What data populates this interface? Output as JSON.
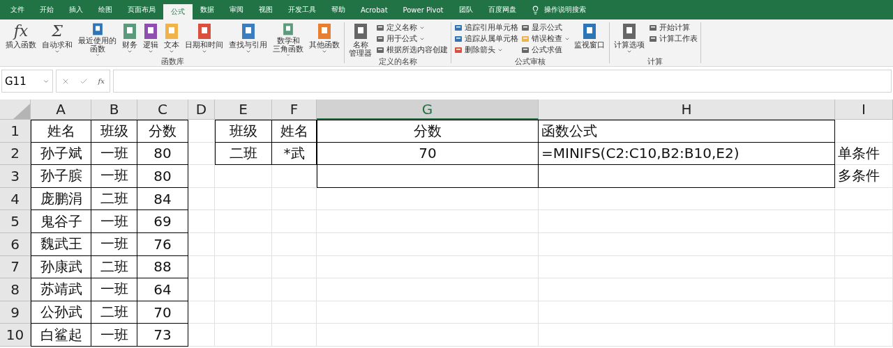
{
  "ribbon_tabs": [
    {
      "label": "文件",
      "selected": false
    },
    {
      "label": "开始",
      "selected": false
    },
    {
      "label": "插入",
      "selected": false
    },
    {
      "label": "绘图",
      "selected": false
    },
    {
      "label": "页面布局",
      "selected": false
    },
    {
      "label": "公式",
      "selected": true
    },
    {
      "label": "数据",
      "selected": false
    },
    {
      "label": "审阅",
      "selected": false
    },
    {
      "label": "视图",
      "selected": false
    },
    {
      "label": "开发工具",
      "selected": false
    },
    {
      "label": "帮助",
      "selected": false
    },
    {
      "label": "Acrobat",
      "selected": false
    },
    {
      "label": "Power Pivot",
      "selected": false
    },
    {
      "label": "团队",
      "selected": false
    },
    {
      "label": "百度网盘",
      "selected": false
    }
  ],
  "tell_me": "操作说明搜索",
  "ribbon_groups": [
    {
      "label": "函数库",
      "items": [
        {
          "kind": "big",
          "glyph": "fx",
          "label": "插入函数",
          "dropdown": false,
          "color": "#444444"
        },
        {
          "kind": "big",
          "glyph": "Σ",
          "label": "自动求和",
          "dropdown": true,
          "color": "#444444"
        },
        {
          "kind": "big",
          "label": [
            "最近使用的",
            "函数"
          ],
          "dropdown": true,
          "color": "#2e75b6"
        },
        {
          "kind": "big",
          "label": "财务",
          "dropdown": true,
          "color": "#5b9b7b"
        },
        {
          "kind": "big",
          "label": "逻辑",
          "dropdown": true,
          "color": "#8e4fb0"
        },
        {
          "kind": "big",
          "label": "文本",
          "dropdown": true,
          "color": "#f0b24a"
        },
        {
          "kind": "big",
          "label": "日期和时间",
          "dropdown": true,
          "color": "#d9503f"
        },
        {
          "kind": "big",
          "label": "查找与引用",
          "dropdown": true,
          "color": "#3e7cc0"
        },
        {
          "kind": "big",
          "label": [
            "数学和",
            "三角函数"
          ],
          "dropdown": true,
          "color": "#5b9b7b"
        },
        {
          "kind": "big",
          "label": "其他函数",
          "dropdown": true,
          "color": "#e67e33"
        }
      ]
    },
    {
      "label": "定义的名称",
      "items": [
        {
          "kind": "big",
          "label": [
            "名称",
            "管理器"
          ],
          "dropdown": false,
          "color": "#666666"
        },
        {
          "kind": "small",
          "label": "定义名称",
          "dropdown": true,
          "color": "#666666"
        },
        {
          "kind": "small",
          "label": "用于公式",
          "dropdown": true,
          "color": "#666666"
        },
        {
          "kind": "small",
          "label": "根据所选内容创建",
          "dropdown": false,
          "color": "#666666"
        }
      ]
    },
    {
      "label": "公式审核",
      "items": [
        {
          "kind": "small",
          "label": "追踪引用单元格",
          "dropdown": false,
          "color": "#2e75b6"
        },
        {
          "kind": "small",
          "label": "追踪从属单元格",
          "dropdown": false,
          "color": "#2e75b6"
        },
        {
          "kind": "small",
          "label": "删除箭头",
          "dropdown": true,
          "color": "#d9503f"
        },
        {
          "kind": "small",
          "label": "显示公式",
          "dropdown": false,
          "color": "#666666"
        },
        {
          "kind": "small",
          "label": "错误检查",
          "dropdown": true,
          "color": "#f0b24a"
        },
        {
          "kind": "small",
          "label": "公式求值",
          "dropdown": false,
          "color": "#666666"
        },
        {
          "kind": "big",
          "label": "监视窗口",
          "dropdown": false,
          "color": "#2e75b6"
        }
      ]
    },
    {
      "label": "计算",
      "items": [
        {
          "kind": "big",
          "label": "计算选项",
          "dropdown": true,
          "color": "#666666"
        },
        {
          "kind": "small",
          "label": "开始计算",
          "dropdown": false,
          "color": "#666666"
        },
        {
          "kind": "small",
          "label": "计算工作表",
          "dropdown": false,
          "color": "#666666"
        }
      ]
    }
  ],
  "formula_bar": {
    "name_box": "G11",
    "function_button": "fx"
  },
  "sheet": {
    "columns": [
      {
        "label": "A",
        "selected": false
      },
      {
        "label": "B",
        "selected": false
      },
      {
        "label": "C",
        "selected": false
      },
      {
        "label": "D",
        "selected": false
      },
      {
        "label": "E",
        "selected": false
      },
      {
        "label": "F",
        "selected": false
      },
      {
        "label": "G",
        "selected": true
      },
      {
        "label": "H",
        "selected": false
      },
      {
        "label": "I",
        "selected": false
      }
    ],
    "rows": [
      {
        "label": "1",
        "cells": [
          "姓名",
          "班级",
          "分数",
          "",
          "班级",
          "姓名",
          "分数",
          "函数公式",
          ""
        ]
      },
      {
        "label": "2",
        "cells": [
          "孙子斌",
          "一班",
          "80",
          "",
          "二班",
          "*武",
          "70",
          "=MINIFS(C2:C10,B2:B10,E2)",
          "单条件"
        ]
      },
      {
        "label": "3",
        "cells": [
          "孙子膑",
          "一班",
          "80",
          "",
          "",
          "",
          "",
          "",
          "多条件"
        ]
      },
      {
        "label": "4",
        "cells": [
          "庞鹏涓",
          "二班",
          "84",
          "",
          "",
          "",
          "",
          "",
          ""
        ]
      },
      {
        "label": "5",
        "cells": [
          "鬼谷子",
          "一班",
          "69",
          "",
          "",
          "",
          "",
          "",
          ""
        ]
      },
      {
        "label": "6",
        "cells": [
          "魏武王",
          "一班",
          "76",
          "",
          "",
          "",
          "",
          "",
          ""
        ]
      },
      {
        "label": "7",
        "cells": [
          "孙康武",
          "二班",
          "88",
          "",
          "",
          "",
          "",
          "",
          ""
        ]
      },
      {
        "label": "8",
        "cells": [
          "苏靖武",
          "一班",
          "64",
          "",
          "",
          "",
          "",
          "",
          ""
        ]
      },
      {
        "label": "9",
        "cells": [
          "公孙武",
          "二班",
          "70",
          "",
          "",
          "",
          "",
          "",
          ""
        ]
      },
      {
        "label": "10",
        "cells": [
          "白鲨起",
          "一班",
          "73",
          "",
          "",
          "",
          "",
          "",
          ""
        ]
      }
    ]
  }
}
